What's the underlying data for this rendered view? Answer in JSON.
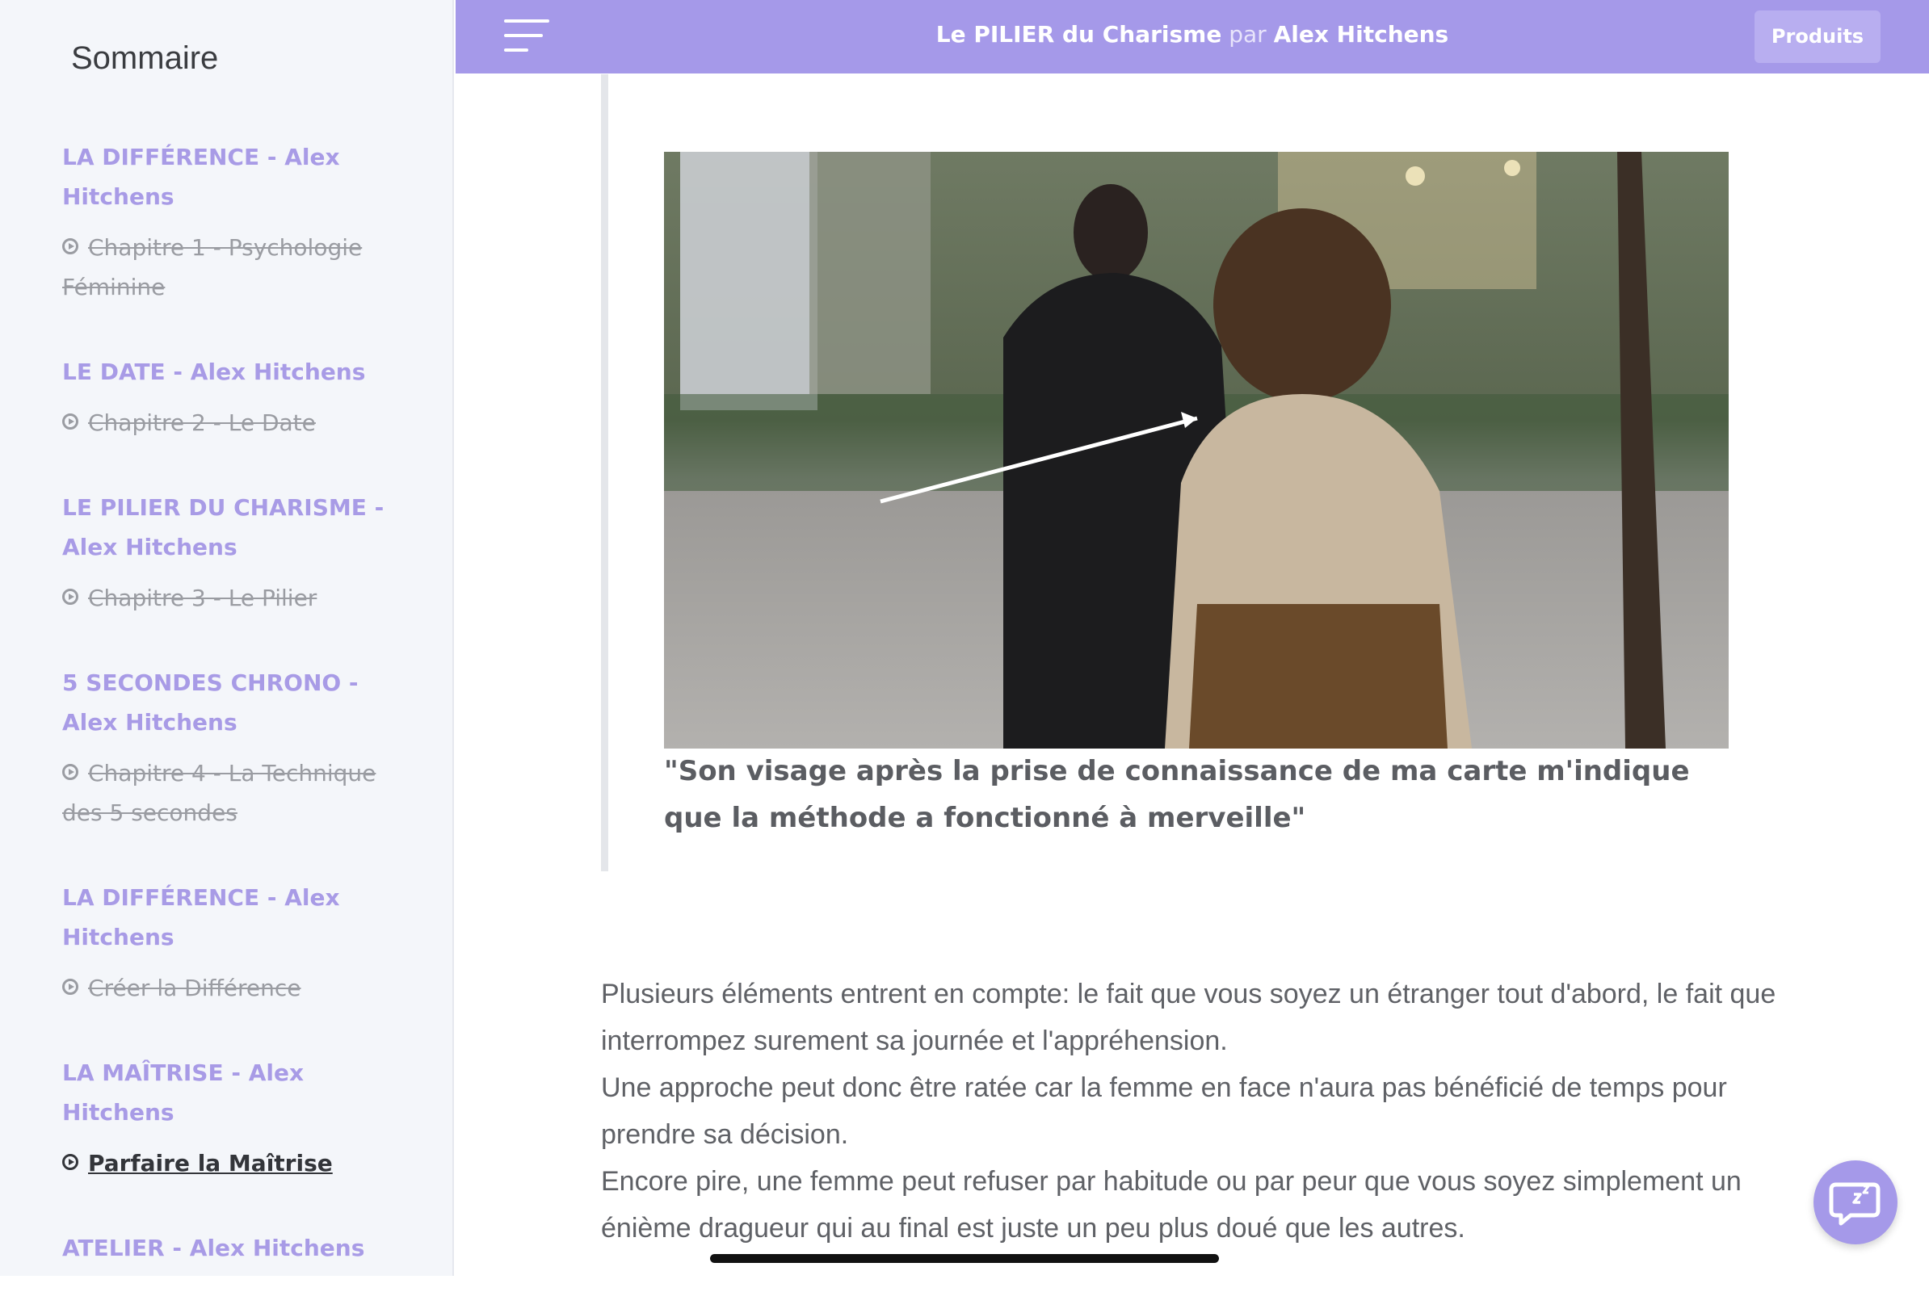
{
  "sidebar": {
    "title": "Sommaire",
    "sections": [
      {
        "title": "LA DIFFÉRENCE - Alex Hitchens",
        "chapter": "Chapitre 1 - Psychologie Féminine"
      },
      {
        "title": "LE DATE - Alex Hitchens",
        "chapter": "Chapitre 2 - Le Date"
      },
      {
        "title": "LE PILIER DU CHARISME - Alex Hitchens",
        "chapter": "Chapitre 3 - Le Pilier"
      },
      {
        "title": "5 SECONDES CHRONO - Alex Hitchens",
        "chapter": "Chapitre 4 - La Technique des 5 secondes"
      },
      {
        "title": "LA DIFFÉRENCE - Alex Hitchens",
        "chapter": "Créer la Différence"
      },
      {
        "title": "LA MAÎTRISE - Alex Hitchens",
        "chapter": "Parfaire la Maîtrise"
      },
      {
        "title": "ATELIER - Alex Hitchens"
      }
    ]
  },
  "header": {
    "title_main": "Le PILIER du Charisme",
    "title_par": "par",
    "title_author": "Alex Hitchens",
    "products_label": "Produits"
  },
  "content": {
    "caption": "\"Son visage après la prise de connaissance de ma carte m'indique que la méthode a   fonctionné à merveille\"",
    "paragraphs": [
      "Plusieurs éléments entrent en compte: le fait que vous soyez un étranger tout d'abord, le fait que interrompez surement sa journée et l'appréhension.",
      "Une approche peut donc être ratée car la femme en face n'aura pas bénéficié de temps pour prendre sa décision.",
      "Encore pire, une femme peut refuser par habitude ou par peur que vous soyez simplement un énième dragueur qui au final est juste un peu plus doué que les autres."
    ]
  },
  "icons": {
    "menu": "hamburger-icon",
    "chapter": "play-circle-icon",
    "chat": "chat-bubble-icon"
  },
  "colors": {
    "accent": "#a599e9",
    "section_title": "#a89be6",
    "sidebar_bg": "#f4f6fa"
  }
}
